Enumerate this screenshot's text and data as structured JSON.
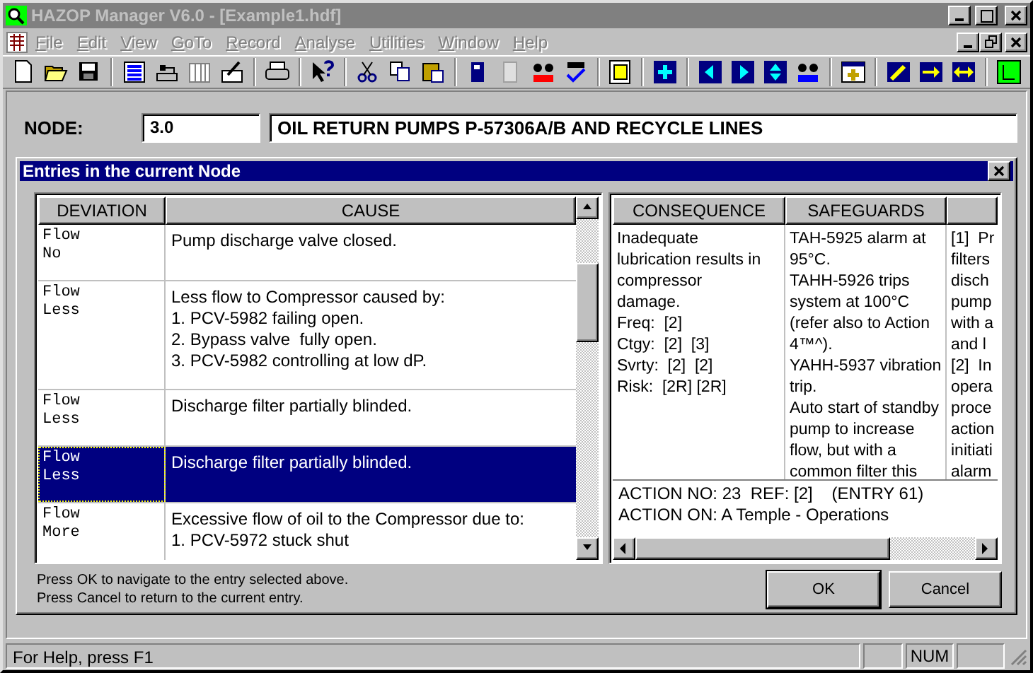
{
  "window": {
    "title": "HAZOP Manager V6.0 - [Example1.hdf]"
  },
  "menu": [
    {
      "label": "File",
      "disabled": true
    },
    {
      "label": "Edit",
      "disabled": true
    },
    {
      "label": "View",
      "disabled": true
    },
    {
      "label": "GoTo",
      "disabled": true
    },
    {
      "label": "Record",
      "disabled": true
    },
    {
      "label": "Analyse",
      "disabled": true
    },
    {
      "label": "Utilities",
      "disabled": true
    },
    {
      "label": "Window",
      "disabled": true
    },
    {
      "label": "Help",
      "disabled": true
    }
  ],
  "node": {
    "label": "NODE:",
    "number": "3.0",
    "description": "OIL RETURN PUMPS P-57306A/B AND RECYCLE LINES"
  },
  "dialog": {
    "title": "Entries in the current Node",
    "entries_table": {
      "columns": [
        "DEVIATION",
        "CAUSE"
      ],
      "rows": [
        {
          "deviation": [
            "Flow",
            "No"
          ],
          "cause": [
            "Pump discharge valve closed."
          ],
          "selected": false
        },
        {
          "deviation": [
            "Flow",
            "Less"
          ],
          "cause": [
            "Less flow to Compressor caused by:",
            "1. PCV-5982 failing open.",
            "2. Bypass valve  fully open.",
            "3. PCV-5982 controlling at low dP."
          ],
          "selected": false
        },
        {
          "deviation": [
            "Flow",
            "Less"
          ],
          "cause": [
            "Discharge filter partially blinded."
          ],
          "selected": false
        },
        {
          "deviation": [
            "Flow",
            "Less"
          ],
          "cause": [
            "Discharge filter partially blinded."
          ],
          "selected": true
        },
        {
          "deviation": [
            "Flow",
            "More"
          ],
          "cause": [
            "Excessive flow of oil to the Compressor due to:",
            "1. PCV-5972 stuck shut"
          ],
          "selected": false
        }
      ]
    },
    "detail_table": {
      "columns": [
        "CONSEQUENCE",
        "SAFEGUARDS"
      ],
      "consequence": [
        "Inadequate",
        "lubrication results in",
        "compressor",
        "damage.",
        "Freq:  [2]",
        "Ctgy:  [2]  [3]",
        "Svrty:  [2]  [2]",
        "Risk:  [2R] [2R]"
      ],
      "safeguards": [
        "TAH-5925 alarm at",
        "95°C.",
        "TAHH-5926 trips",
        "system at 100°C",
        "(refer also to Action",
        "4™^).",
        "YAHH-5937 vibration",
        "trip.",
        "Auto start of standby",
        "pump to increase",
        "flow, but with a",
        "common filter this"
      ],
      "column_3": [
        "[1]  Pr",
        "filters",
        "disch",
        "pump",
        "with a",
        "and l",
        "[2]  In",
        "opera",
        "proce",
        "action",
        "initiati",
        "alarm"
      ]
    },
    "action": [
      "ACTION NO: 23  REF: [2]    (ENTRY 61)",
      "ACTION ON: A Temple - Operations"
    ],
    "hint": [
      "Press OK to navigate to the entry selected above.",
      "Press Cancel to return to the current entry."
    ],
    "buttons": [
      {
        "label": "OK",
        "default": true
      },
      {
        "label": "Cancel",
        "default": false
      }
    ]
  },
  "status_bar": {
    "text": "For Help, press F1",
    "indicators": [
      "NUM"
    ]
  }
}
